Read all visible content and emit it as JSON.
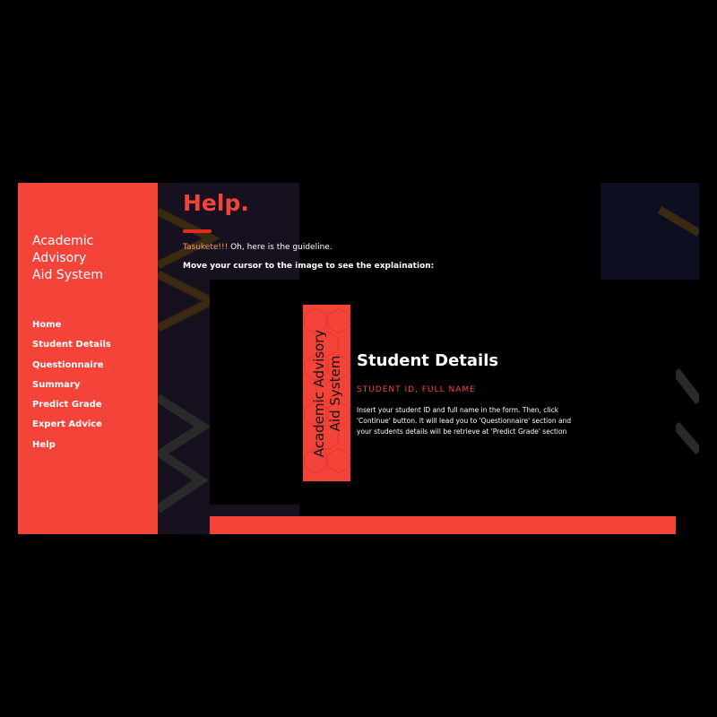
{
  "brand": {
    "line1": "Academic",
    "line2": "Advisory",
    "line3": "Aid System"
  },
  "nav": {
    "items": [
      {
        "label": "Home"
      },
      {
        "label": "Student Details"
      },
      {
        "label": "Questionnaire"
      },
      {
        "label": "Summary"
      },
      {
        "label": "Predict Grade"
      },
      {
        "label": "Expert Advice"
      },
      {
        "label": "Help"
      }
    ]
  },
  "main": {
    "title": "Help.",
    "intro_accent": "Tasukete!!!",
    "intro_text": " Oh, here is the guideline.",
    "instruction": "Move your cursor to the image to see the explaination:"
  },
  "feature": {
    "card_line1": "Academic Advisory",
    "card_line2": "Aid System",
    "title": "Student Details",
    "subtitle": "STUDENT ID, FULL NAME",
    "description": "Insert your student ID and full name in the form. Then, click 'Continue' button. It will lead you to 'Questionnaire' section and your students details will be retrieve at 'Predict Grade' section"
  },
  "colors": {
    "accent": "#f4443a",
    "background": "#000000",
    "text": "#ffffff"
  }
}
